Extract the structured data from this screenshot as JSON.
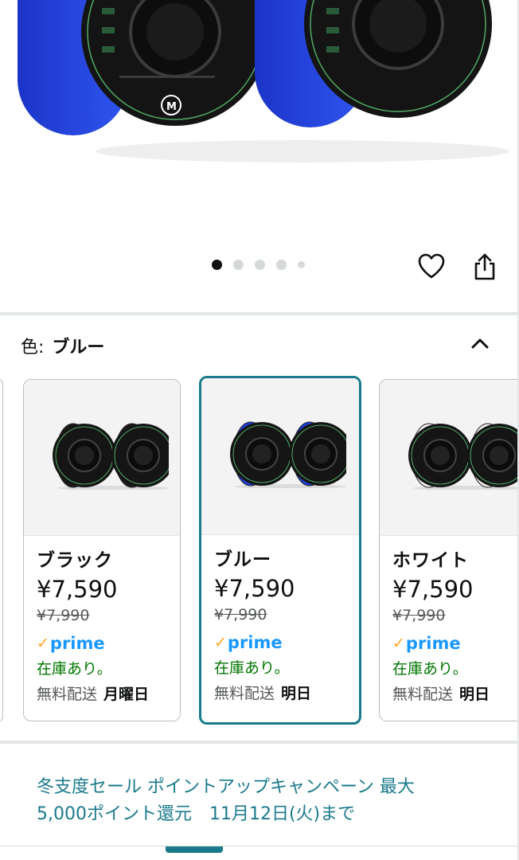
{
  "gallery": {
    "dot_count": 5,
    "active_index": 0
  },
  "actions": {
    "like_icon": "heart-outline-icon",
    "share_icon": "share-icon"
  },
  "color_selector": {
    "label": "色:",
    "selected_value": "ブルー",
    "toggle_icon": "chevron-up-icon"
  },
  "variants": [
    {
      "name": "ブラック",
      "price": "¥7,590",
      "list_price": "¥7,990",
      "prime": "prime",
      "stock": "在庫あり。",
      "shipping_label": "無料配送",
      "shipping_day": "月曜日",
      "filament_color": "#1a1a1a",
      "selected": false
    },
    {
      "name": "ブルー",
      "price": "¥7,590",
      "list_price": "¥7,990",
      "prime": "prime",
      "stock": "在庫あり。",
      "shipping_label": "無料配送",
      "shipping_day": "明日",
      "filament_color": "#1f3fd8",
      "selected": true
    },
    {
      "name": "ホワイト",
      "price": "¥7,590",
      "list_price": "¥7,990",
      "prime": "prime",
      "stock": "在庫あり。",
      "shipping_label": "無料配送",
      "shipping_day": "明日",
      "filament_color": "#f2f2f2",
      "selected": false
    }
  ],
  "promo": {
    "line1": "冬支度セール ポイントアップキャンペーン 最大",
    "line2": "5,000ポイント還元　11月12日(火)まで"
  },
  "colors": {
    "accent": "#187a8a",
    "link": "#1b7a8c",
    "in_stock": "#007600",
    "prime_blue": "#1a98ff",
    "prime_check": "#ffa41c"
  }
}
